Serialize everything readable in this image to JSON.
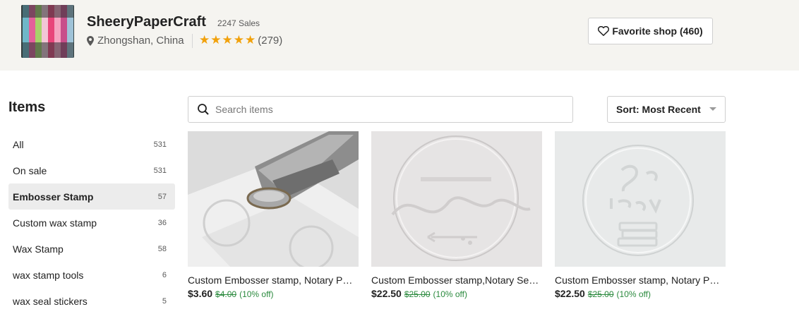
{
  "shop": {
    "name": "SheeryPaperCraft",
    "sales": "2247 Sales",
    "location": "Zhongshan, China",
    "rating_count": "(279)",
    "rating_stars": 5,
    "favorite_label": "Favorite shop (460)"
  },
  "sidebar": {
    "heading": "Items",
    "items": [
      {
        "label": "All",
        "count": "531"
      },
      {
        "label": "On sale",
        "count": "531"
      },
      {
        "label": "Embosser Stamp",
        "count": "57"
      },
      {
        "label": "Custom wax stamp",
        "count": "36"
      },
      {
        "label": "Wax Stamp",
        "count": "58"
      },
      {
        "label": "wax stamp tools",
        "count": "6"
      },
      {
        "label": "wax seal stickers",
        "count": "5"
      }
    ],
    "active_index": 2
  },
  "search": {
    "placeholder": "Search items"
  },
  "sort": {
    "label": "Sort: Most Recent"
  },
  "listings": [
    {
      "title": "Custom Embosser stamp, Notary Public Seal",
      "price": "$3.60",
      "original_price": "$4.00",
      "discount": "(10% off)"
    },
    {
      "title": "Custom Embosser stamp,Notary Seal, Library",
      "price": "$22.50",
      "original_price": "$25.00",
      "discount": "(10% off)"
    },
    {
      "title": "Custom Embosser stamp, Notary Public Seal",
      "price": "$22.50",
      "original_price": "$25.00",
      "discount": "(10% off)"
    }
  ],
  "colors": {
    "accent_star": "#f1a10b",
    "discount_green": "#2b8a3e",
    "header_bg": "#f5f4f0"
  }
}
